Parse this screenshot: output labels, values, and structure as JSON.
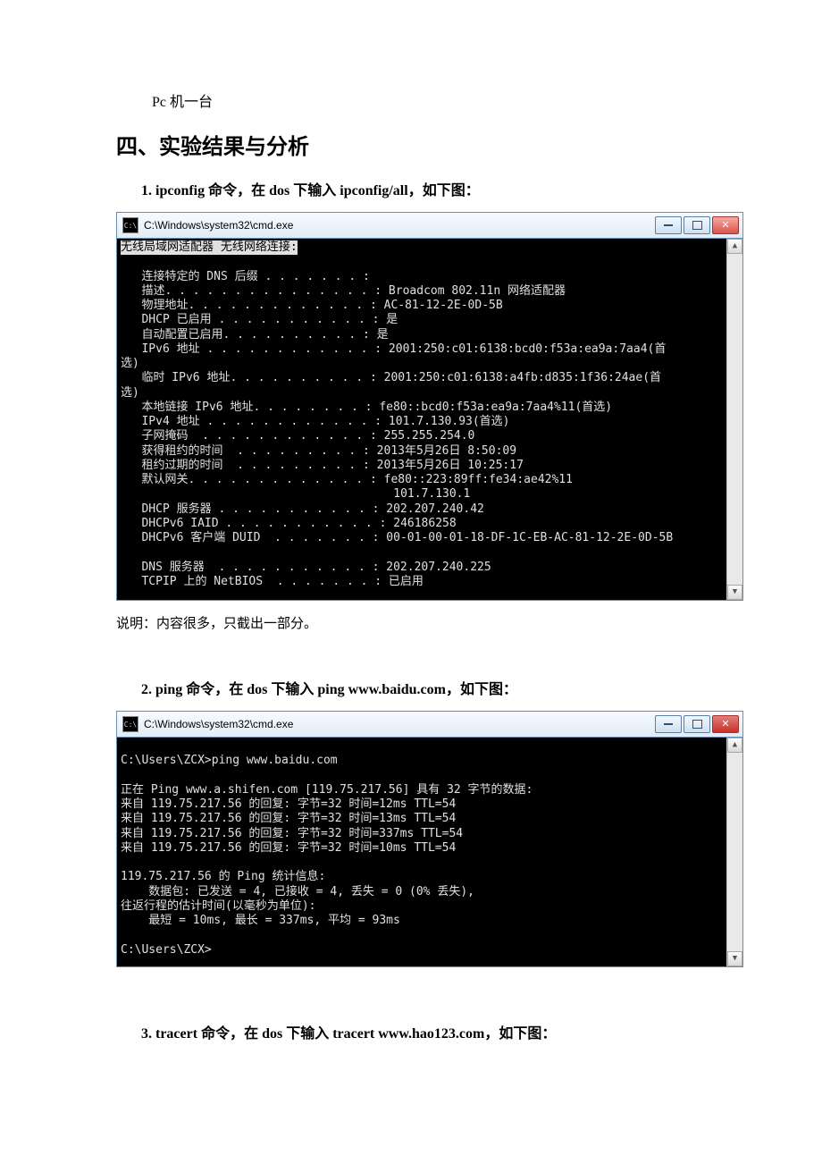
{
  "pre_line": "Pc 机一台",
  "section_heading": "四、实验结果与分析",
  "step1_label": "1. ipconfig 命令，在 dos 下输入 ipconfig/all，如下图：",
  "step2_label": "2. ping 命令，在 dos 下输入 ping www.baidu.com，如下图：",
  "step3_label": "3. tracert 命令，在 dos 下输入 tracert www.hao123.com，如下图：",
  "caption_after_win1": "说明：内容很多，只截出一部分。",
  "win1": {
    "title": "C:\\Windows\\system32\\cmd.exe",
    "heading_reverse": "无线局域网适配器 无线网络连接:",
    "lines": {
      "l01": "   连接特定的 DNS 后缀 . . . . . . . :",
      "l02": "   描述. . . . . . . . . . . . . . . : Broadcom 802.11n 网络适配器",
      "l03": "   物理地址. . . . . . . . . . . . . : AC-81-12-2E-0D-5B",
      "l04": "   DHCP 已启用 . . . . . . . . . . . : 是",
      "l05": "   自动配置已启用. . . . . . . . . . : 是",
      "l06": "   IPv6 地址 . . . . . . . . . . . . : 2001:250:c01:6138:bcd0:f53a:ea9a:7aa4(首",
      "l06b": "选)",
      "l07": "   临时 IPv6 地址. . . . . . . . . . : 2001:250:c01:6138:a4fb:d835:1f36:24ae(首",
      "l07b": "选)",
      "l08": "   本地链接 IPv6 地址. . . . . . . . : fe80::bcd0:f53a:ea9a:7aa4%11(首选)",
      "l09": "   IPv4 地址 . . . . . . . . . . . . : 101.7.130.93(首选)",
      "l10": "   子网掩码  . . . . . . . . . . . . : 255.255.254.0",
      "l11": "   获得租约的时间  . . . . . . . . . : 2013年5月26日 8:50:09",
      "l12": "   租约过期的时间  . . . . . . . . . : 2013年5月26日 10:25:17",
      "l13": "   默认网关. . . . . . . . . . . . . : fe80::223:89ff:fe34:ae42%11",
      "l14": "                                       101.7.130.1",
      "l15": "   DHCP 服务器 . . . . . . . . . . . : 202.207.240.42",
      "l16": "   DHCPv6 IAID . . . . . . . . . . . : 246186258",
      "l17": "   DHCPv6 客户端 DUID  . . . . . . . : 00-01-00-01-18-DF-1C-EB-AC-81-12-2E-0D-5B",
      "l18": "",
      "l19": "   DNS 服务器  . . . . . . . . . . . : 202.207.240.225",
      "l20": "   TCPIP 上的 NetBIOS  . . . . . . . : 已启用"
    }
  },
  "win2": {
    "title": "C:\\Windows\\system32\\cmd.exe",
    "lines": {
      "l00": "",
      "l01": "C:\\Users\\ZCX>ping www.baidu.com",
      "l02": "",
      "l03": "正在 Ping www.a.shifen.com [119.75.217.56] 具有 32 字节的数据:",
      "l04": "来自 119.75.217.56 的回复: 字节=32 时间=12ms TTL=54",
      "l05": "来自 119.75.217.56 的回复: 字节=32 时间=13ms TTL=54",
      "l06": "来自 119.75.217.56 的回复: 字节=32 时间=337ms TTL=54",
      "l07": "来自 119.75.217.56 的回复: 字节=32 时间=10ms TTL=54",
      "l08": "",
      "l09": "119.75.217.56 的 Ping 统计信息:",
      "l10": "    数据包: 已发送 = 4, 已接收 = 4, 丢失 = 0 (0% 丢失),",
      "l11": "往返行程的估计时间(以毫秒为单位):",
      "l12": "    最短 = 10ms, 最长 = 337ms, 平均 = 93ms",
      "l13": "",
      "l14": "C:\\Users\\ZCX>"
    }
  }
}
